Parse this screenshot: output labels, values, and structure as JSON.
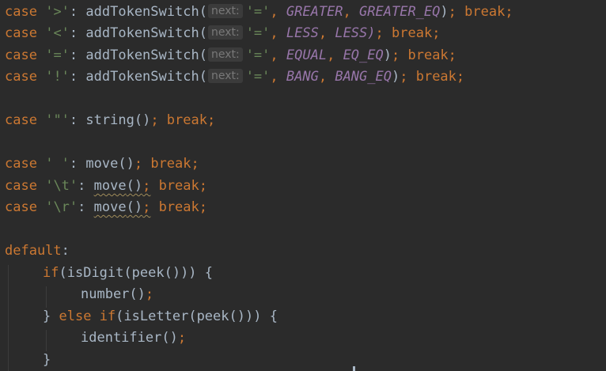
{
  "tokens": {
    "case": "case",
    "break": "break",
    "default": "default",
    "if": "if",
    "else": "else",
    "addTokenSwitch": "addTokenSwitch",
    "string": "string",
    "move": "move",
    "number": "number",
    "identifier": "identifier",
    "isDigit": "isDigit",
    "isLetter": "isLetter",
    "peek": "peek",
    "hint_next": "next:",
    "eq_char": "'='",
    "chars": {
      "gt": "'>'",
      "lt": "'<'",
      "eq": "'='",
      "bang": "'!'",
      "quote": "'\"'",
      "space": "' '",
      "tab": "'\\t'",
      "cr": "'\\r'"
    },
    "constants": {
      "GREATER": "GREATER",
      "GREATER_EQ": "GREATER_EQ",
      "LESS": "LESS",
      "LESS_EQ": "LESS)",
      "EQUAL": "EQUAL",
      "EQ_EQ": "EQ_EQ",
      "BANG": "BANG",
      "BANG_EQ": "BANG_EQ"
    }
  }
}
